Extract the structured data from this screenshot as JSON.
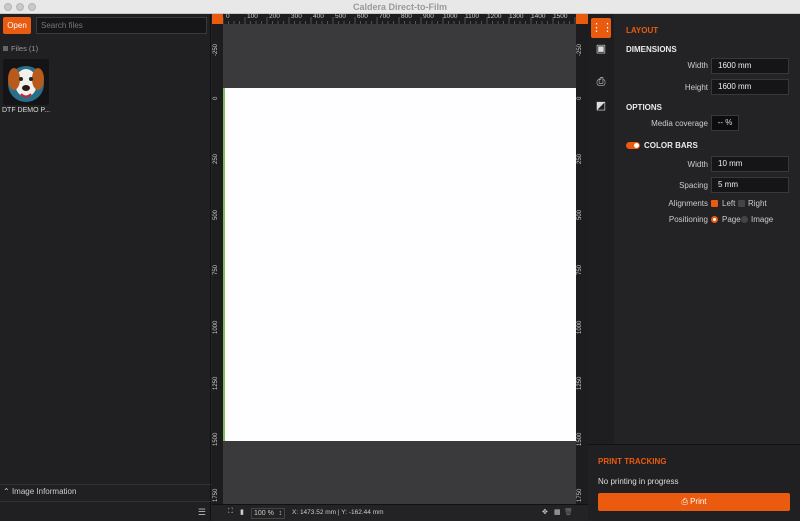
{
  "window": {
    "title": "Caldera Direct-to-Film"
  },
  "left": {
    "open_label": "Open",
    "search_placeholder": "Search files",
    "files_label": "Files (1)",
    "file_name": "DTF DEMO P...",
    "image_info_label": "Image Information"
  },
  "canvas": {
    "ruler_top_ticks": [
      "0",
      "100",
      "200",
      "300",
      "400",
      "500",
      "600",
      "700",
      "800",
      "900",
      "1000",
      "1100",
      "1200",
      "1300",
      "1400",
      "1500"
    ],
    "ruler_left_ticks": [
      "-250",
      "0",
      "250",
      "500",
      "750",
      "1000",
      "1250",
      "1500",
      "1750"
    ],
    "zoom": "100 %",
    "coords": "X: 1473.52 mm  |  Y: -162.44 mm"
  },
  "panel": {
    "layout_title": "LAYOUT",
    "dimensions_title": "DIMENSIONS",
    "width_label": "Width",
    "width_value": "1600 mm",
    "height_label": "Height",
    "height_value": "1600 mm",
    "options_title": "OPTIONS",
    "coverage_label": "Media coverage",
    "coverage_value": "-- %",
    "colorbars_title": "COLOR BARS",
    "cb_width_label": "Width",
    "cb_width_value": "10 mm",
    "spacing_label": "Spacing",
    "spacing_value": "5 mm",
    "alignments_label": "Alignments",
    "align_left": "Left",
    "align_right": "Right",
    "positioning_label": "Positioning",
    "pos_page": "Page",
    "pos_image": "Image"
  },
  "tracking": {
    "title": "PRINT TRACKING",
    "status": "No printing in progress",
    "print_label": "Print"
  },
  "colors": {
    "accent": "#ea5a0f",
    "page": "#fefdff",
    "workspace": "#3a393c"
  }
}
